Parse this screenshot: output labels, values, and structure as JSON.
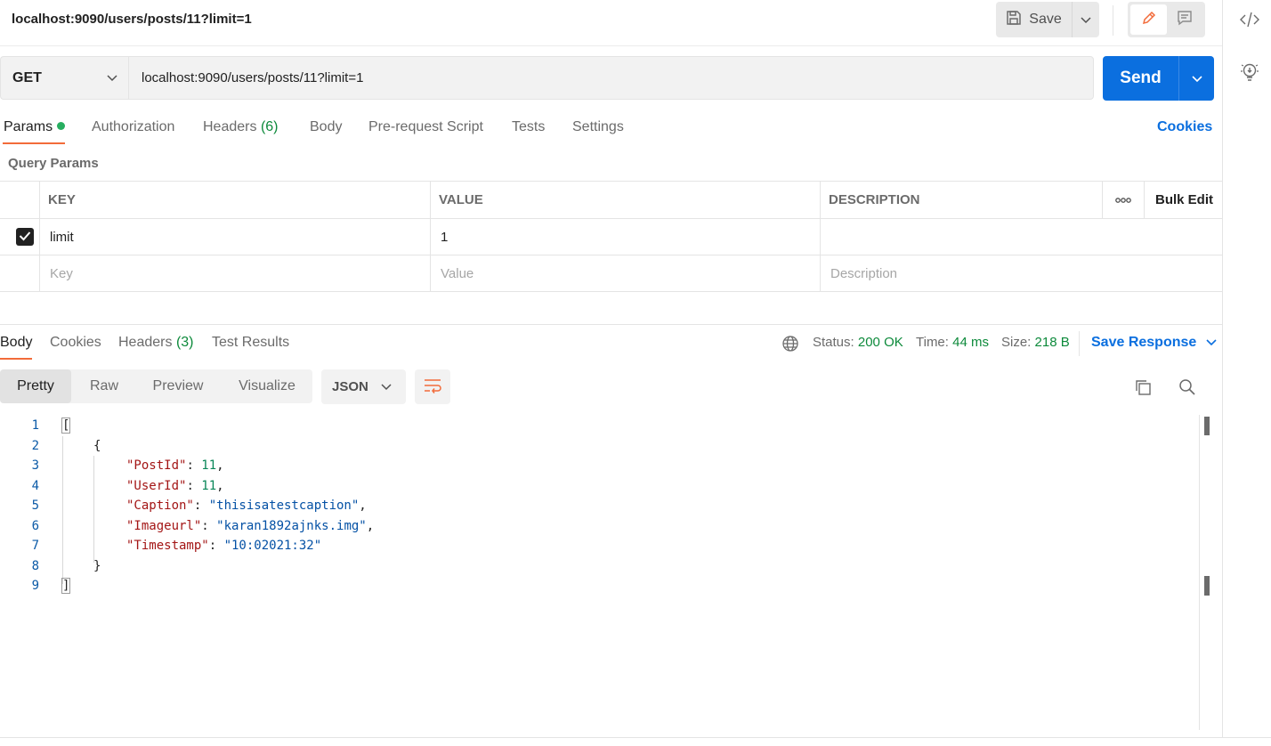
{
  "header": {
    "title": "localhost:9090/users/posts/11?limit=1",
    "save_label": "Save"
  },
  "request": {
    "method": "GET",
    "url": "localhost:9090/users/posts/11?limit=1",
    "send_label": "Send"
  },
  "request_tabs": {
    "params": "Params",
    "authorization": "Authorization",
    "headers": "Headers",
    "headers_count": "(6)",
    "body": "Body",
    "prerequest": "Pre-request Script",
    "tests": "Tests",
    "settings": "Settings",
    "cookies": "Cookies"
  },
  "query_params": {
    "label": "Query Params",
    "columns": {
      "key": "KEY",
      "value": "VALUE",
      "description": "DESCRIPTION",
      "more": "ooo",
      "bulk_edit": "Bulk Edit"
    },
    "rows": [
      {
        "checked": true,
        "key": "limit",
        "value": "1",
        "description": ""
      }
    ],
    "placeholders": {
      "key": "Key",
      "value": "Value",
      "description": "Description"
    }
  },
  "response_tabs": {
    "body": "Body",
    "cookies": "Cookies",
    "headers": "Headers",
    "headers_count": "(3)",
    "test_results": "Test Results"
  },
  "response_meta": {
    "status_label": "Status:",
    "status_value": "200 OK",
    "time_label": "Time:",
    "time_value": "44 ms",
    "size_label": "Size:",
    "size_value": "218 B",
    "save_response": "Save Response"
  },
  "view_modes": {
    "pretty": "Pretty",
    "raw": "Raw",
    "preview": "Preview",
    "visualize": "Visualize",
    "format": "JSON"
  },
  "response_body": {
    "line_numbers": [
      "1",
      "2",
      "3",
      "4",
      "5",
      "6",
      "7",
      "8",
      "9"
    ],
    "open_array": "[",
    "open_obj": "{",
    "fields": [
      {
        "key": "\"PostId\"",
        "sep": ": ",
        "value": "11",
        "trail": ",",
        "type": "num"
      },
      {
        "key": "\"UserId\"",
        "sep": ": ",
        "value": "11",
        "trail": ",",
        "type": "num"
      },
      {
        "key": "\"Caption\"",
        "sep": ": ",
        "value": "\"thisisatestcaption\"",
        "trail": ",",
        "type": "str"
      },
      {
        "key": "\"Imageurl\"",
        "sep": ": ",
        "value": "\"karan1892ajnks.img\"",
        "trail": ",",
        "type": "str"
      },
      {
        "key": "\"Timestamp\"",
        "sep": ": ",
        "value": "\"10:02021:32\"",
        "trail": "",
        "type": "str"
      }
    ],
    "close_obj": "}",
    "close_array": "]"
  },
  "colors": {
    "accent_orange": "#f26b3a",
    "primary_blue": "#0b6fdf",
    "success_green": "#0d8a3b"
  }
}
